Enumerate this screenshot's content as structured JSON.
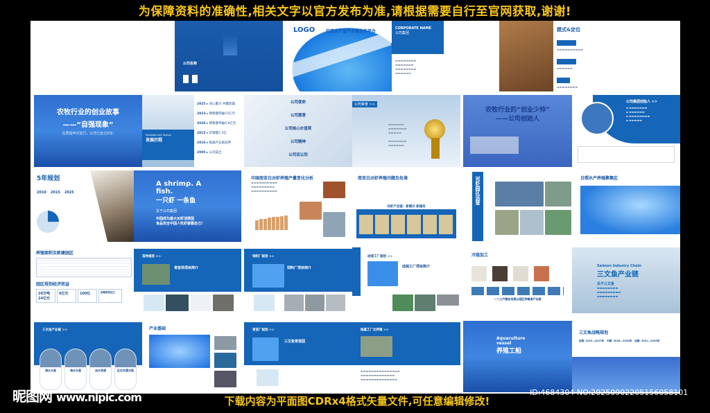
{
  "banner": {
    "top": "为保障资料的准确性,相关文字以官方发布为准,请根据需要自行至官网获取,谢谢!",
    "bottom": "下载内容为平面图CDRx4格式矢量文件,可任意编辑修改!"
  },
  "watermark": {
    "site_cn": "昵图网",
    "site_url": "www.nipic.com",
    "id": "ID:4684304 NO:20250902205156058101"
  },
  "row0": {
    "cover_company": "公司名称",
    "logo": "LOGO",
    "platform": "打造水产全产业链合作平台",
    "corporate": "CORPORATE NAME",
    "corporate_cn": "公司集团",
    "positioning": "模式&定位"
  },
  "row1": {
    "story_title1": "农牧行业的创业故事",
    "story_title2": "——“自强现象”",
    "story_sub": "在质疑声中前行，公司已走过6年!",
    "history_en": "Development History",
    "history": "发展历程",
    "timeline": [
      {
        "year": "2025",
        "text": "同心聚力 共赢新篇"
      },
      {
        "year": "2023",
        "text": "销售额突破15亿元"
      },
      {
        "year": "2020",
        "text": "销售额突破6.8亿元"
      },
      {
        "year": "2015",
        "text": "年销量5.3亿"
      },
      {
        "year": "2010",
        "text": "拓展产业链延伸"
      },
      {
        "year": "2005",
        "text": "公司成立"
      }
    ],
    "values": [
      "公司使命",
      "公司愿景",
      "公司核心价值观",
      "公司精神",
      "公司双认同"
    ],
    "honor": "公司荣誉 >>",
    "founder_title1": "农牧行业的“创业少帅”",
    "founder_title2": "——公司创始人",
    "founder_card": "公司集团创始人 >>"
  },
  "row2": {
    "plan": "5年规划",
    "years": [
      "2010",
      "2015",
      "2025"
    ],
    "shrimp_en": "A shrimp. A fish.",
    "shrimp_cn": "一只虾 一条鱼",
    "about": "关于公司集团",
    "slogan1": "中国成为最大对虾消费国",
    "slogan2": "食品安全中国人吃虾要靠自己!",
    "analysis": "中国南亚白对虾养殖产量变化分析",
    "problems": "南亚白对虾养殖问题及处境",
    "chain": "对虾产业链：新模式 新服务",
    "park": "对虾园区运营",
    "cluster": "日照水产养殖聚集区"
  },
  "row3": {
    "area": "养殖面积及新建园区",
    "benefit": "园区规划经济效益",
    "stats": [
      "20万吨",
      "24亿元",
      "6亿元",
      "100亿",
      "创意研发加工"
    ],
    "seed": "苗种规划 >>",
    "seed_intro": "育苗场项目简介",
    "feed": "饲料厂规划 >>",
    "feed_intro": "饲料厂项目简介",
    "vet": "动保工厂规划 >>",
    "vet_intro": "动保工厂项目简介",
    "cold": "冷链加工",
    "cold_chain": "一二三产融合发展从园区到餐桌产业链",
    "salmon_en": "Salmon Industry Chain",
    "salmon_cn": "三文鱼产业链",
    "salmon_about": "关于三文鱼"
  },
  "row4": {
    "salmon_chain": "三文鱼产业链 >>",
    "circles": [
      "海水水面",
      "海水水面",
      "淡水资源",
      "区位交通方面"
    ],
    "base": "产业基础",
    "hatchery": "育苗厂规划 >>",
    "hatchery_sub": "三文鱼育苗园",
    "land": "陆基工厂化养殖 >>",
    "vessel_en": "Aquaculture vessel",
    "vessel_cn": "养殖工船",
    "strategy": "三文鱼战略规划",
    "phases": [
      "近期: 2023—2027年",
      "中期: 2028—2030年",
      "远期: 2031—2035年"
    ]
  }
}
